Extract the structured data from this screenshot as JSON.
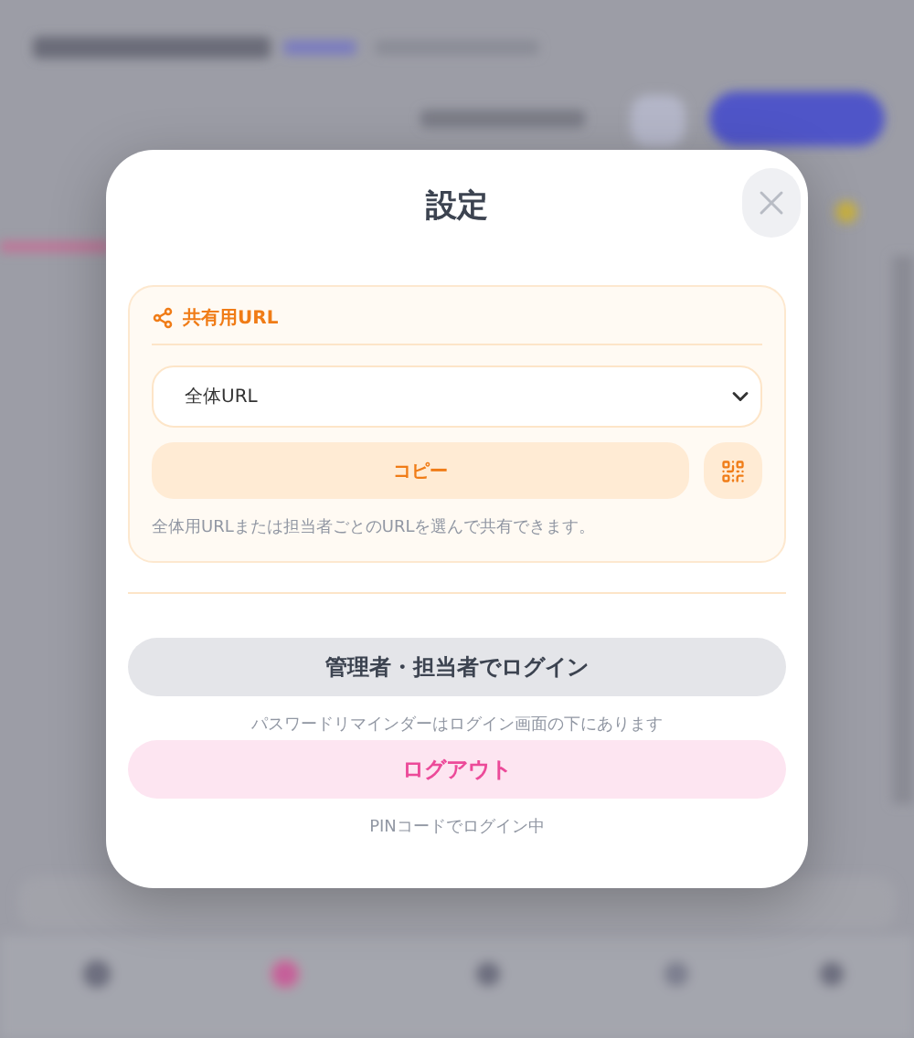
{
  "dialog": {
    "title": "設定"
  },
  "share": {
    "heading": "共有用URL",
    "select": {
      "value": "全体URL"
    },
    "copy_button": "コピー",
    "help": "全体用URLまたは担当者ごとのURLを選んで共有できます。"
  },
  "admin_login": {
    "label": "管理者・担当者でログイン",
    "note": "パスワードリマインダーはログイン画面の下にあります"
  },
  "logout": {
    "label": "ログアウト",
    "note": "PINコードでログイン中"
  }
}
